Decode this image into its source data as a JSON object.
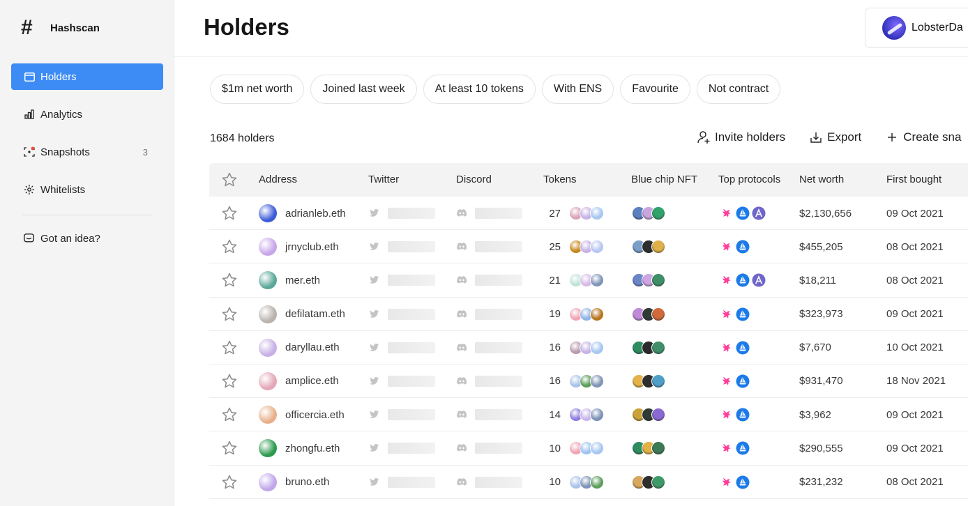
{
  "app": {
    "name": "Hashscan",
    "logo_glyph": "#"
  },
  "sidebar": {
    "items": [
      {
        "label": "Holders",
        "icon": "window-icon",
        "active": true
      },
      {
        "label": "Analytics",
        "icon": "bar-chart-icon"
      },
      {
        "label": "Snapshots",
        "icon": "camera-focus-icon",
        "count": "3"
      },
      {
        "label": "Whitelists",
        "icon": "sparkle-icon"
      }
    ],
    "idea_label": "Got an idea?"
  },
  "header": {
    "title": "Holders",
    "user_name": "LobsterDa"
  },
  "filters": [
    "$1m net worth",
    "Joined last week",
    "At least 10 tokens",
    "With ENS",
    "Favourite",
    "Not contract"
  ],
  "toolbar": {
    "count_label": "1684 holders",
    "invite_label": "Invite holders",
    "export_label": "Export",
    "create_label": "Create sna"
  },
  "table": {
    "columns": [
      "Address",
      "Twitter",
      "Discord",
      "Tokens",
      "Blue chip NFT",
      "Top protocols",
      "Net worth",
      "First bought"
    ],
    "rows": [
      {
        "address": "adrianleb.eth",
        "tokens": "27",
        "net_worth": "$2,130,656",
        "first_bought": "09 Oct 2021",
        "avatar_color": "#3b5bd9",
        "coins": [
          "#d9a3b8",
          "#c6b3e6",
          "#a8c7f0"
        ],
        "nfts": [
          "#5b7fbf",
          "#c9a5e0",
          "#2fa36b"
        ],
        "protocols": [
          "uniswap",
          "openocean",
          "aave"
        ]
      },
      {
        "address": "jrnyclub.eth",
        "tokens": "25",
        "net_worth": "$455,205",
        "first_bought": "08 Oct 2021",
        "avatar_color": "#c8a7e9",
        "coins": [
          "#c78a20",
          "#c6b3e6",
          "#b7c6f2"
        ],
        "nfts": [
          "#7aa0c9",
          "#2e2e2e",
          "#e0b04a"
        ],
        "protocols": [
          "uniswap",
          "openocean"
        ]
      },
      {
        "address": "mer.eth",
        "tokens": "21",
        "net_worth": "$18,211",
        "first_bought": "08 Oct 2021",
        "avatar_color": "#5aa89a",
        "coins": [
          "#bfe3d9",
          "#d7b9e8",
          "#7f96b8"
        ],
        "nfts": [
          "#6a86c8",
          "#cfa6e4",
          "#3f8f6a"
        ],
        "protocols": [
          "uniswap",
          "openocean",
          "aave"
        ]
      },
      {
        "address": "defilatam.eth",
        "tokens": "19",
        "net_worth": "$323,973",
        "first_bought": "09 Oct 2021",
        "avatar_color": "#b9b2ad",
        "coins": [
          "#f0a4b3",
          "#8fb4e6",
          "#b8741e"
        ],
        "nfts": [
          "#c08ad8",
          "#2f3a35",
          "#d06a3a"
        ],
        "protocols": [
          "uniswap",
          "openocean"
        ]
      },
      {
        "address": "daryllau.eth",
        "tokens": "16",
        "net_worth": "$7,670",
        "first_bought": "10 Oct 2021",
        "avatar_color": "#c7b0e6",
        "coins": [
          "#b89bb0",
          "#c6b3e6",
          "#a8c7f0"
        ],
        "nfts": [
          "#2e8d5f",
          "#2b2b2b",
          "#3f8f6a"
        ],
        "protocols": [
          "uniswap",
          "openocean"
        ]
      },
      {
        "address": "amplice.eth",
        "tokens": "16",
        "net_worth": "$931,470",
        "first_bought": "18 Nov 2021",
        "avatar_color": "#e4a7b8",
        "coins": [
          "#a9c2ea",
          "#5c9e5a",
          "#8094b4"
        ],
        "nfts": [
          "#e5b14a",
          "#2e2e2e",
          "#4fa0c9"
        ],
        "protocols": [
          "uniswap",
          "openocean"
        ]
      },
      {
        "address": "officercia.eth",
        "tokens": "14",
        "net_worth": "$3,962",
        "first_bought": "09 Oct 2021",
        "avatar_color": "#e8b08a",
        "coins": [
          "#8f7de0",
          "#c9b7ea",
          "#7d92b6"
        ],
        "nfts": [
          "#c9a33a",
          "#2f3a35",
          "#8a6ad0"
        ],
        "protocols": [
          "uniswap",
          "openocean"
        ]
      },
      {
        "address": "zhongfu.eth",
        "tokens": "10",
        "net_worth": "$290,555",
        "first_bought": "09 Oct 2021",
        "avatar_color": "#2d9a4e",
        "coins": [
          "#f0a4b3",
          "#9fc3f0",
          "#a8c7f0"
        ],
        "nfts": [
          "#2e8d5f",
          "#e3b246",
          "#3d7a56"
        ],
        "protocols": [
          "uniswap",
          "openocean"
        ]
      },
      {
        "address": "bruno.eth",
        "tokens": "10",
        "net_worth": "$231,232",
        "first_bought": "08 Oct 2021",
        "avatar_color": "#c2a6ea",
        "coins": [
          "#a9c2ea",
          "#7f93b6",
          "#5c9e5a"
        ],
        "nfts": [
          "#d8a85e",
          "#2e2e2e",
          "#3f9a6a"
        ],
        "protocols": [
          "uniswap",
          "openocean"
        ]
      }
    ]
  },
  "colors": {
    "accent": "#3d8bf4",
    "uniswap": "#ff3e9a",
    "openocean": "#1d7be8",
    "aave": "#6f66c9"
  }
}
